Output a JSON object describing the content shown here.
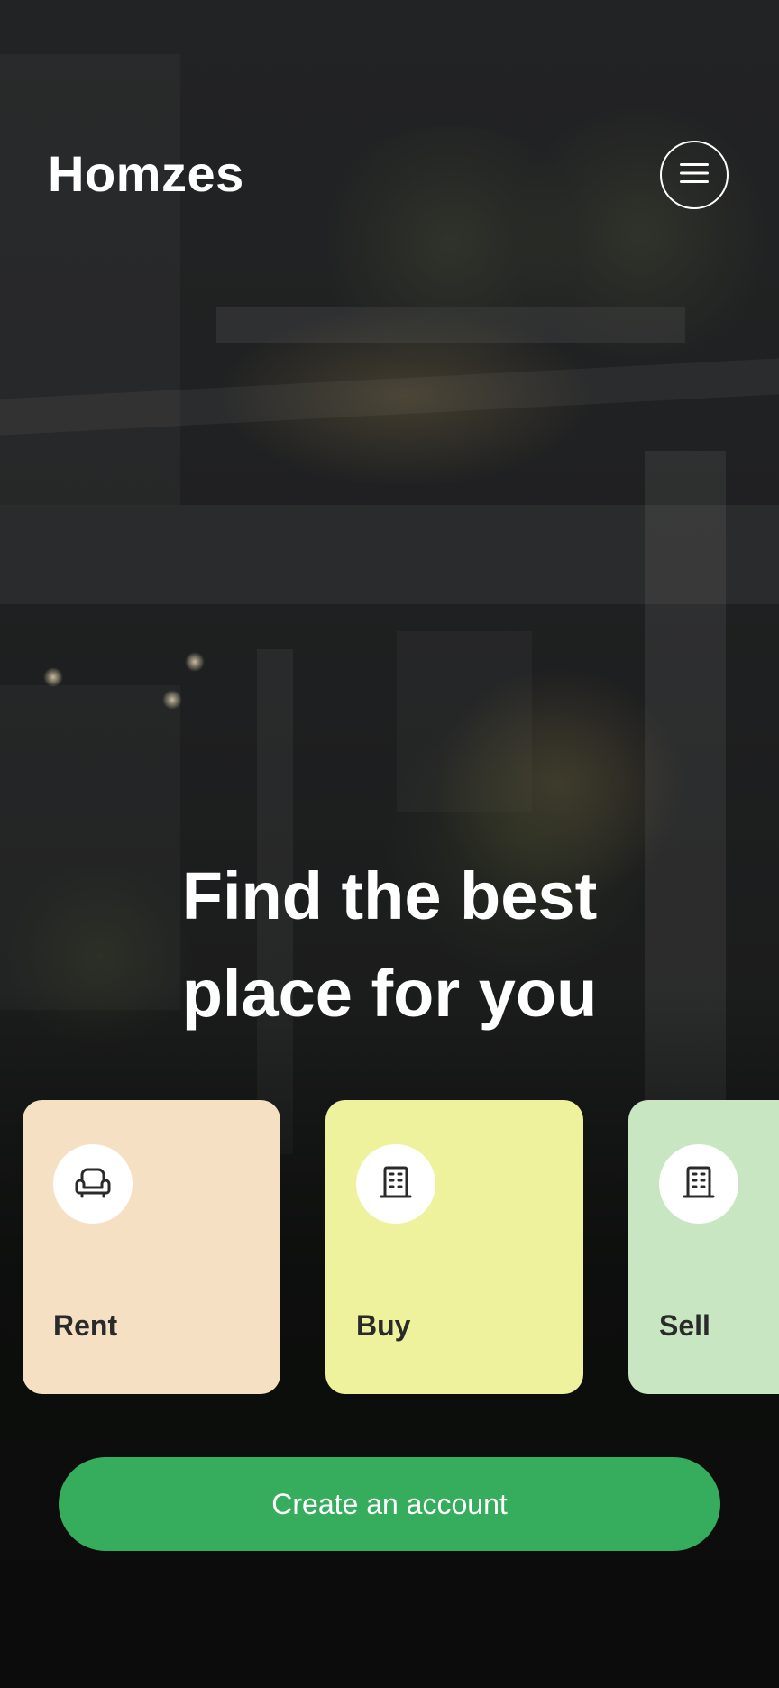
{
  "app": {
    "brand": "Homzes"
  },
  "hero": {
    "headline_line1": "Find the best",
    "headline_line2": "place for you"
  },
  "cards": [
    {
      "label": "Rent",
      "icon": "armchair-icon",
      "color": "#f6e0c3"
    },
    {
      "label": "Buy",
      "icon": "building-icon",
      "color": "#eef29c"
    },
    {
      "label": "Sell",
      "icon": "building-icon",
      "color": "#c8e6c1"
    }
  ],
  "cta": {
    "label": "Create an account",
    "color": "#35ad5d"
  },
  "icons": {
    "menu": "hamburger-menu-icon"
  }
}
